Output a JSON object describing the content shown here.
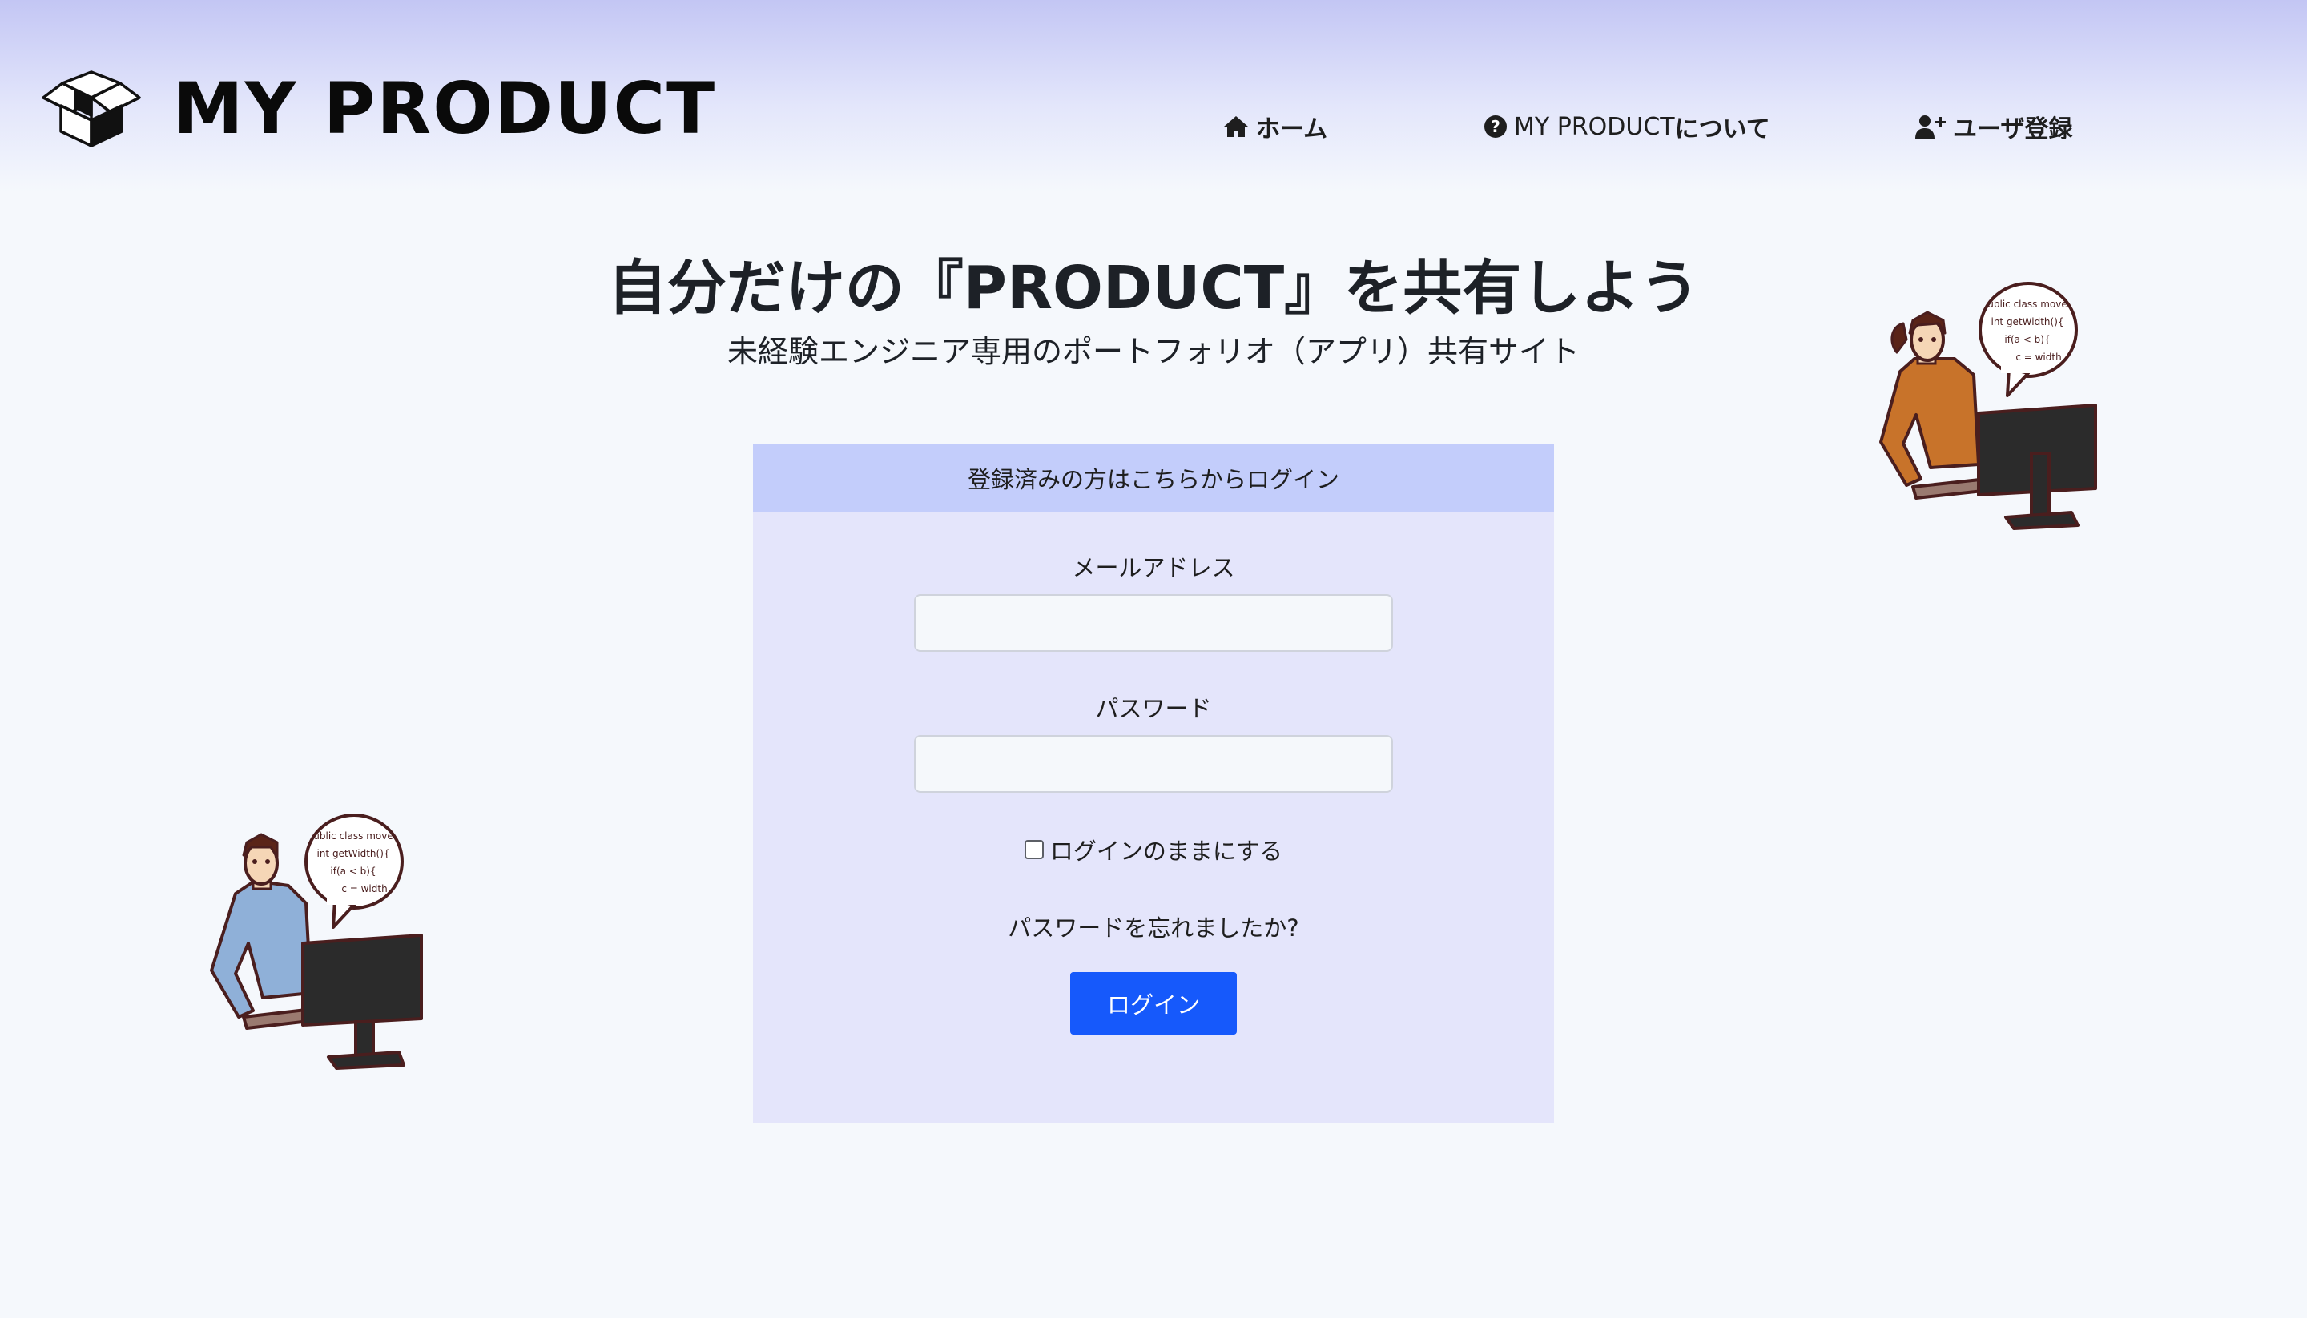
{
  "brand": {
    "name": "MY PRODUCT"
  },
  "nav": {
    "home_label": "ホーム",
    "about_prefix": "MY PRODUCT",
    "about_suffix": "について",
    "register_label": "ユーザ登録"
  },
  "hero": {
    "title": "自分だけの『PRODUCT』を共有しよう",
    "subtitle": "未経験エンジニア専用のポートフォリオ（アプリ）共有サイト"
  },
  "login": {
    "header": "登録済みの方はこちらからログイン",
    "email_label": "メールアドレス",
    "email_value": "",
    "password_label": "パスワード",
    "password_value": "",
    "remember_label": "ログインのままにする",
    "forgot_label": "パスワードを忘れましたか?",
    "submit_label": "ログイン"
  },
  "speech_bubble": {
    "line1": "ublic class move",
    "line2": "int getWidth(){",
    "line3": "if(a < b){",
    "line4": "c = width"
  },
  "colors": {
    "header_gradient_top": "#c3c6f4",
    "page_background": "#f5f8fc",
    "card_background": "#e4e5fb",
    "card_header": "#c3cdfb",
    "primary_button": "#1659fb"
  },
  "icons": {
    "logo": "open-box-icon",
    "home": "home-icon",
    "about": "question-circle-icon",
    "register": "user-plus-icon"
  }
}
